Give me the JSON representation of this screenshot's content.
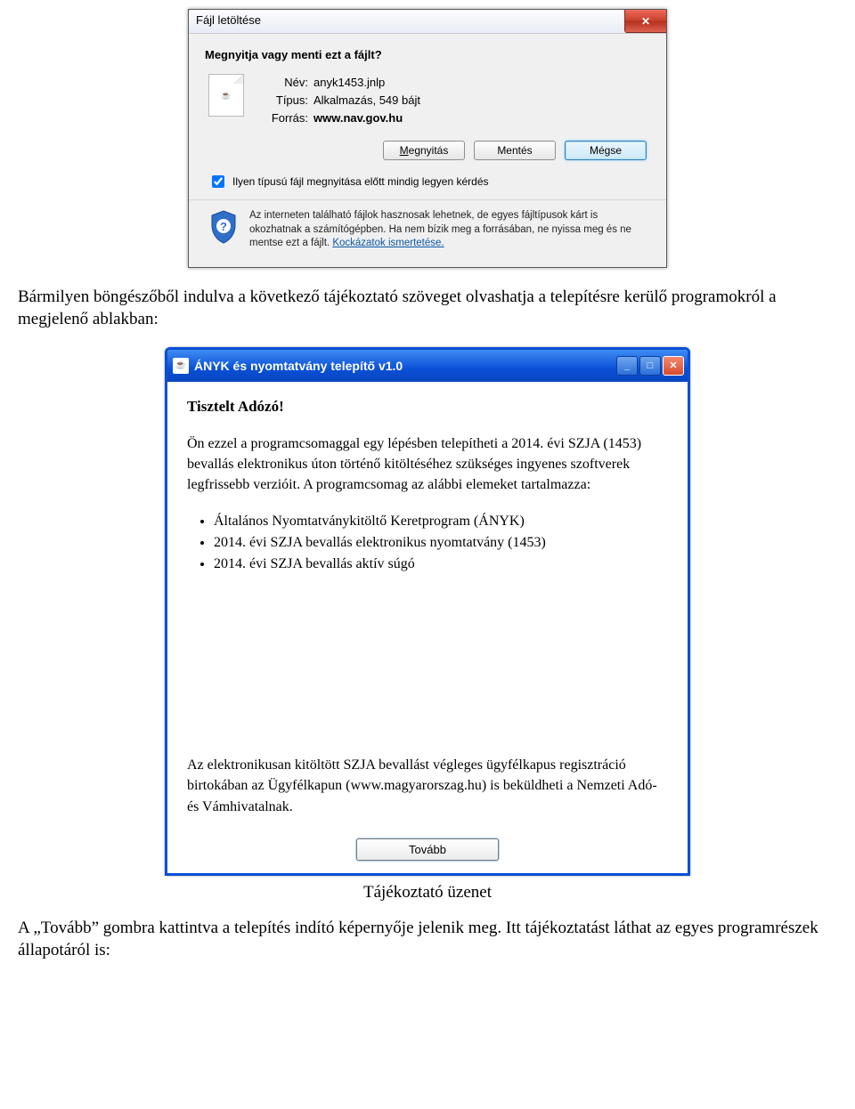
{
  "win7": {
    "title": "Fájl letöltése",
    "question": "Megnyitja vagy menti ezt a fájlt?",
    "nameLabel": "Név:",
    "nameValue": "anyk1453.jnlp",
    "typeLabel": "Típus:",
    "typeValue": "Alkalmazás, 549 bájt",
    "sourceLabel": "Forrás:",
    "sourceValue": "www.nav.gov.hu",
    "openBtn": "Megnyitás",
    "saveBtn": "Mentés",
    "cancelBtn": "Mégse",
    "checkboxLabel": "Ilyen típusú fájl megnyitása előtt mindig legyen kérdés",
    "warningText": "Az interneten található fájlok hasznosak lehetnek, de egyes fájltípusok kárt is okozhatnak a számítógépben. Ha nem bízik meg a forrásában, ne nyissa meg és ne mentse ezt a fájlt. ",
    "warningLink": "Kockázatok ismertetése."
  },
  "doc": {
    "para1": "Bármilyen böngészőből indulva a következő tájékoztató szöveget olvashatja a telepítésre kerülő programokról a megjelenő ablakban:",
    "caption": "Tájékoztató üzenet",
    "para2": "A „Tovább” gombra kattintva a telepítés indító képernyője jelenik meg. Itt tájékoztatást láthat az egyes programrészek állapotáról is:"
  },
  "xp": {
    "title": "ÁNYK és nyomtatvány telepítő v1.0",
    "greeting": "Tisztelt Adózó!",
    "p1": "Ön ezzel a programcsomaggal egy lépésben telepítheti a 2014. évi SZJA (1453) bevallás elektronikus úton történő kitöltéséhez szükséges ingyenes szoftverek legfrissebb verzióit. A programcsomag az alábbi elemeket tartalmazza:",
    "li1": "Általános Nyomtatványkitöltő Keretprogram (ÁNYK)",
    "li2": "2014. évi SZJA bevallás elektronikus nyomtatvány (1453)",
    "li3": "2014. évi SZJA bevallás aktív súgó",
    "p2": "Az elektronikusan kitöltött SZJA bevallást végleges ügyfélkapus regisztráció birtokában az Ügyfélkapun (www.magyarorszag.hu) is beküldheti a Nemzeti Adó- és Vámhivatalnak.",
    "nextBtn": "Tovább"
  }
}
